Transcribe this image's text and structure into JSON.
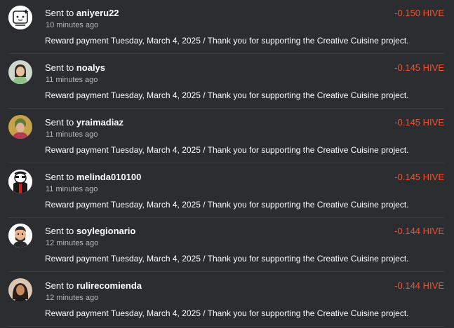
{
  "colors": {
    "background": "#2b2d31",
    "amount_negative": "#f0532e",
    "divider": "#3a3c41"
  },
  "transactions": [
    {
      "prefix": "Sent to",
      "recipient": "aniyeru22",
      "time_ago": "10 minutes ago",
      "amount": "-0.150 HIVE",
      "memo": "Reward payment Tuesday, March 4, 2025 / Thank you for supporting the Creative Cuisine project.",
      "avatar_icon": "avatar-aniyeru22"
    },
    {
      "prefix": "Sent to",
      "recipient": "noalys",
      "time_ago": "11 minutes ago",
      "amount": "-0.145 HIVE",
      "memo": "Reward payment Tuesday, March 4, 2025 / Thank you for supporting the Creative Cuisine project.",
      "avatar_icon": "avatar-noalys"
    },
    {
      "prefix": "Sent to",
      "recipient": "yraimadiaz",
      "time_ago": "11 minutes ago",
      "amount": "-0.145 HIVE",
      "memo": "Reward payment Tuesday, March 4, 2025 / Thank you for supporting the Creative Cuisine project.",
      "avatar_icon": "avatar-yraimadiaz"
    },
    {
      "prefix": "Sent to",
      "recipient": "melinda010100",
      "time_ago": "11 minutes ago",
      "amount": "-0.145 HIVE",
      "memo": "Reward payment Tuesday, March 4, 2025 / Thank you for supporting the Creative Cuisine project.",
      "avatar_icon": "avatar-melinda010100"
    },
    {
      "prefix": "Sent to",
      "recipient": "soylegionario",
      "time_ago": "12 minutes ago",
      "amount": "-0.144 HIVE",
      "memo": "Reward payment Tuesday, March 4, 2025 / Thank you for supporting the Creative Cuisine project.",
      "avatar_icon": "avatar-soylegionario"
    },
    {
      "prefix": "Sent to",
      "recipient": "rulirecomienda",
      "time_ago": "12 minutes ago",
      "amount": "-0.144 HIVE",
      "memo": "Reward payment Tuesday, March 4, 2025 / Thank you for supporting the Creative Cuisine project.",
      "avatar_icon": "avatar-rulirecomienda"
    }
  ]
}
